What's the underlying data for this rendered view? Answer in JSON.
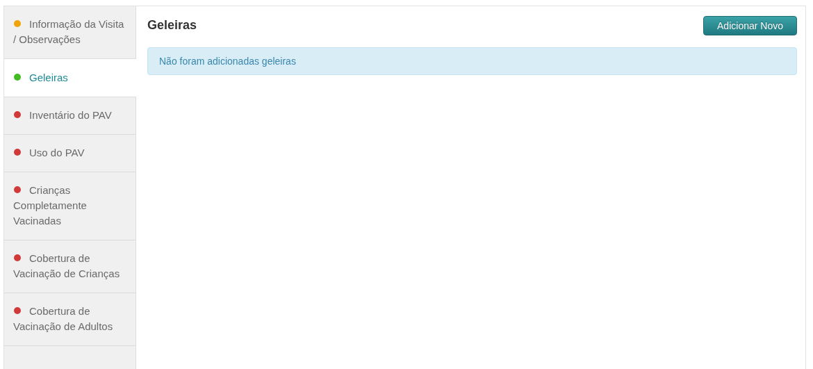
{
  "sidebar": {
    "items": [
      {
        "label": "Informação da Visita / Observações",
        "color": "#f0a30a",
        "selected": false
      },
      {
        "label": "Geleiras",
        "color": "#44bb22",
        "selected": true
      },
      {
        "label": "Inventário do PAV",
        "color": "#d03a3a",
        "selected": false
      },
      {
        "label": "Uso do PAV",
        "color": "#d03a3a",
        "selected": false
      },
      {
        "label": "Crianças Completamente Vacinadas",
        "color": "#d03a3a",
        "selected": false
      },
      {
        "label": "Cobertura de Vacinação de Crianças",
        "color": "#d03a3a",
        "selected": false
      },
      {
        "label": "Cobertura de Vacinação de Adultos",
        "color": "#d03a3a",
        "selected": false
      }
    ]
  },
  "main": {
    "title": "Geleiras",
    "add_button": "Adicionar Novo",
    "alert": "Não foram adicionadas geleiras"
  }
}
